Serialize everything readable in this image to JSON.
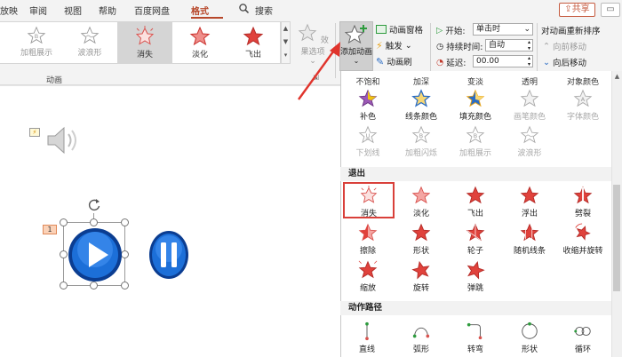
{
  "menu": {
    "items": [
      "放映",
      "审阅",
      "视图",
      "帮助",
      "百度网盘",
      "格式"
    ],
    "active": "格式",
    "search_label": "搜索",
    "share_label": "共享",
    "comment_icon": "comment-icon"
  },
  "ribbon": {
    "gallery": [
      {
        "label": "加粗展示",
        "state": "disabled"
      },
      {
        "label": "波浪形",
        "state": "disabled"
      },
      {
        "label": "消失",
        "state": "selected"
      },
      {
        "label": "淡化",
        "state": "normal"
      },
      {
        "label": "飞出",
        "state": "normal"
      }
    ],
    "effect_options_label": "效果选项",
    "add_animation_label": "添加动画",
    "animation_pane_label": "动画窗格",
    "trigger_label": "触发",
    "painter_label": "动画刷",
    "start_label": "开始:",
    "start_value": "单击时",
    "duration_label": "持续时间:",
    "duration_value": "自动",
    "delay_label": "延迟:",
    "delay_value": "00.00",
    "reorder_title": "对动画重新排序",
    "move_earlier_label": "向前移动",
    "move_later_label": "向后移动",
    "group_label": "动画"
  },
  "panel": {
    "emphasis_headers": [
      "不饱和",
      "加深",
      "变淡",
      "透明",
      "对象颜色"
    ],
    "emphasis_row1": [
      {
        "label": "补色",
        "enabled": true
      },
      {
        "label": "线条颜色",
        "enabled": true
      },
      {
        "label": "填充颜色",
        "enabled": true
      },
      {
        "label": "画笔颜色",
        "enabled": false
      },
      {
        "label": "字体颜色",
        "enabled": false
      }
    ],
    "emphasis_row2": [
      {
        "label": "下划线",
        "enabled": false
      },
      {
        "label": "加粗闪烁",
        "enabled": false
      },
      {
        "label": "加粗展示",
        "enabled": false
      },
      {
        "label": "波浪形",
        "enabled": false
      }
    ],
    "exit_title": "退出",
    "exit_row1": [
      "消失",
      "淡化",
      "飞出",
      "浮出",
      "劈裂"
    ],
    "exit_row2": [
      "擦除",
      "形状",
      "轮子",
      "随机线条",
      "收缩并旋转"
    ],
    "exit_row3": [
      "缩放",
      "旋转",
      "弹跳"
    ],
    "exit_selected": "消失",
    "path_title": "动作路径",
    "path_row": [
      "直线",
      "弧形",
      "转弯",
      "形状",
      "循环"
    ]
  },
  "slide": {
    "animation_tag": "1",
    "trigger_tag_icon": "lightning-icon",
    "speaker_icon": "speaker-icon",
    "play_icon": "play-button-icon",
    "pause_icon": "pause-button-icon"
  }
}
